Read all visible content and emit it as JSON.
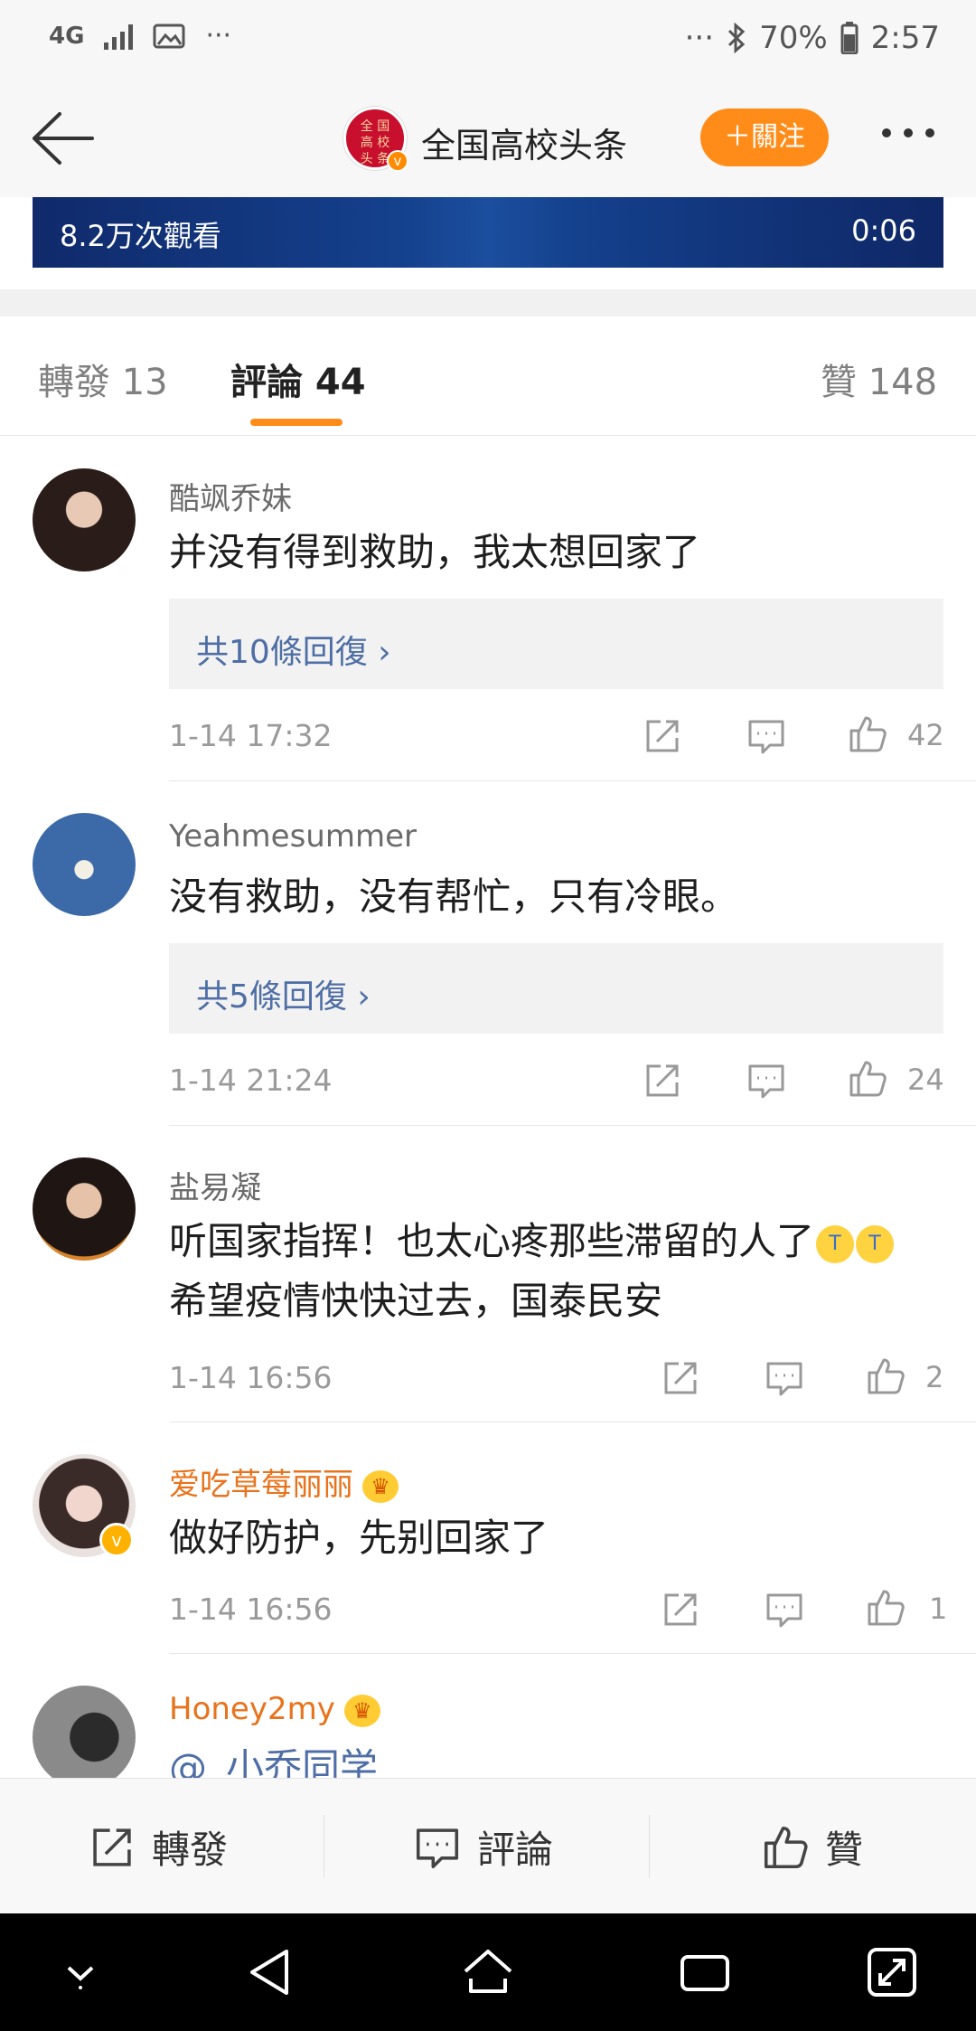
{
  "status_bar": {
    "network": "4G",
    "battery": "70%",
    "time": "2:57",
    "icons": [
      "signal-icon",
      "gallery-icon",
      "more-dots-icon",
      "bluetooth-icon",
      "battery-icon"
    ]
  },
  "header": {
    "title": "全国高校头条",
    "logo_text": "全国高校头条",
    "follow_label": "＋關注",
    "accent": "#ff8c19"
  },
  "video": {
    "views": "8.2万次觀看",
    "duration": "0:06"
  },
  "tabs": [
    {
      "label": "轉發 13"
    },
    {
      "label": "評論 44",
      "active": true
    },
    {
      "label": "贊 148"
    }
  ],
  "comments": [
    {
      "name": "酷飒乔妹",
      "text": "并没有得到救助，我太想回家了",
      "replies": "共10條回復 ›",
      "time": "1-14 17:32",
      "likes": "42"
    },
    {
      "name": "Yeahmesummer",
      "text": "没有救助，没有帮忙，只有冷眼。",
      "replies": "共5條回復 ›",
      "time": "1-14 21:24",
      "likes": "24"
    },
    {
      "name": "盐易凝",
      "text_line1": "听国家指挥！也太心疼那些滞留的人了",
      "text_line2": "希望疫情快快过去，国泰民安",
      "time": "1-14 16:56",
      "likes": "2"
    },
    {
      "name": "爱吃草莓丽丽",
      "text": "做好防护，先别回家了",
      "time": "1-14 16:56",
      "likes": "1"
    },
    {
      "name": "Honey2my",
      "text": "@_小乔同学"
    }
  ],
  "bottom_bar": {
    "repost": "轉發",
    "comment": "評論",
    "like": "贊"
  },
  "nav": [
    "down-icon",
    "back-icon",
    "home-icon",
    "recents-icon",
    "expand-icon"
  ]
}
